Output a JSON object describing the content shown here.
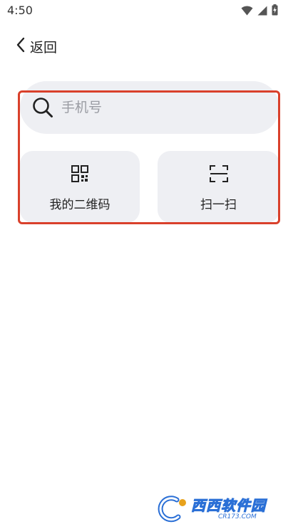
{
  "status_bar": {
    "time": "4:50",
    "icons": [
      "wifi-icon",
      "signal-icon",
      "battery-charging-icon"
    ]
  },
  "header": {
    "back_label": "返回"
  },
  "search": {
    "placeholder": "手机号",
    "value": ""
  },
  "actions": {
    "my_qr_label": "我的二维码",
    "scan_label": "扫一扫"
  },
  "watermark": {
    "text": "西西软件园",
    "sub": "CR173.COM"
  },
  "colors": {
    "highlight_border": "#d9402b",
    "card_background": "#eeeff3",
    "placeholder_text": "#9a9ca3",
    "watermark_blue": "#2a6fd6"
  }
}
